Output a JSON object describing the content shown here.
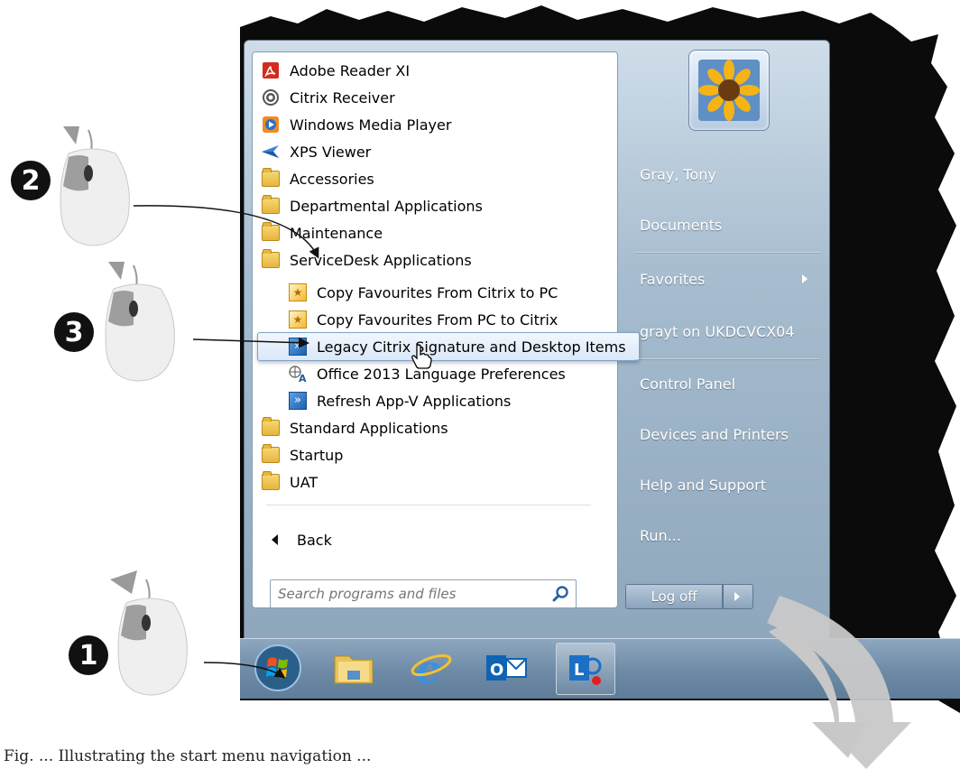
{
  "programs": [
    {
      "label": "Adobe Reader XI",
      "icon": "adobe-reader-icon"
    },
    {
      "label": "Citrix Receiver",
      "icon": "citrix-receiver-icon"
    },
    {
      "label": "Windows Media Player",
      "icon": "media-player-icon"
    },
    {
      "label": "XPS Viewer",
      "icon": "xps-viewer-icon"
    },
    {
      "label": "Accessories",
      "icon": "folder-icon"
    },
    {
      "label": "Departmental Applications",
      "icon": "folder-icon"
    },
    {
      "label": "Maintenance",
      "icon": "folder-icon"
    },
    {
      "label": "ServiceDesk Applications",
      "icon": "folder-icon"
    },
    {
      "label": "Copy Favourites From Citrix to PC",
      "icon": "shortcut-icon"
    },
    {
      "label": "Copy Favourites From PC to Citrix",
      "icon": "shortcut-icon"
    },
    {
      "label": "Legacy Citrix Signature and Desktop Items",
      "icon": "appv-icon"
    },
    {
      "label": "Office 2013 Language Preferences",
      "icon": "language-icon"
    },
    {
      "label": "Refresh App-V Applications",
      "icon": "appv-icon"
    },
    {
      "label": "Standard Applications",
      "icon": "folder-icon"
    },
    {
      "label": "Startup",
      "icon": "folder-icon"
    },
    {
      "label": "UAT",
      "icon": "folder-icon"
    }
  ],
  "selected_program": "Legacy Citrix Signature and Desktop Items",
  "back_label": "Back",
  "search": {
    "placeholder": "Search programs and files"
  },
  "right_pane": {
    "user": "Gray, Tony",
    "documents": "Documents",
    "favorites": "Favorites",
    "computer": "grayt on UKDCVCX04",
    "control_panel": "Control Panel",
    "devices": "Devices and Printers",
    "help": "Help and Support",
    "run": "Run..."
  },
  "logoff_label": "Log off",
  "taskbar": [
    "start-orb",
    "file-explorer",
    "internet-explorer",
    "outlook",
    "lync"
  ],
  "annotations": {
    "step1": "1",
    "step2": "2",
    "step3": "3"
  },
  "caption": "Fig. ... Illustrating the start menu navigation ...",
  "colors": {
    "accent_selection": "#dbe8f7",
    "taskbar": "#6d8aa6",
    "arrow": "#c8c8c8"
  }
}
